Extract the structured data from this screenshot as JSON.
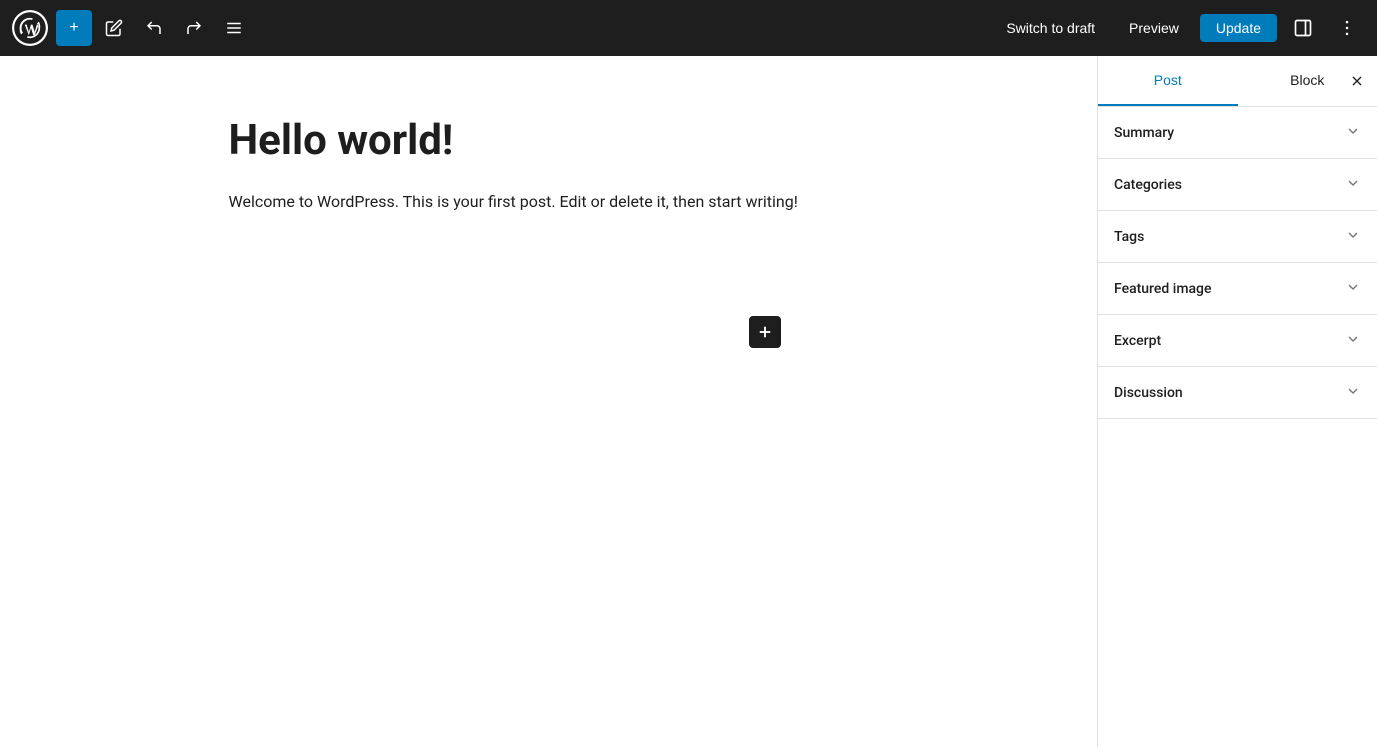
{
  "toolbar": {
    "add_label": "+",
    "switch_to_draft_label": "Switch to draft",
    "preview_label": "Preview",
    "update_label": "Update"
  },
  "editor": {
    "post_title": "Hello world!",
    "post_body": "Welcome to WordPress. This is your first post. Edit or delete it, then start writing!"
  },
  "sidebar": {
    "tab_post_label": "Post",
    "tab_block_label": "Block",
    "sections": [
      {
        "id": "summary",
        "label": "Summary"
      },
      {
        "id": "categories",
        "label": "Categories"
      },
      {
        "id": "tags",
        "label": "Tags"
      },
      {
        "id": "featured_image",
        "label": "Featured image"
      },
      {
        "id": "excerpt",
        "label": "Excerpt"
      },
      {
        "id": "discussion",
        "label": "Discussion"
      }
    ]
  },
  "icons": {
    "plus": "+",
    "pencil": "✏",
    "undo": "↩",
    "redo": "↪",
    "list": "≡",
    "chevron_down": "›",
    "close": "✕",
    "more": "⋮",
    "sidebar_icon": "▣"
  }
}
